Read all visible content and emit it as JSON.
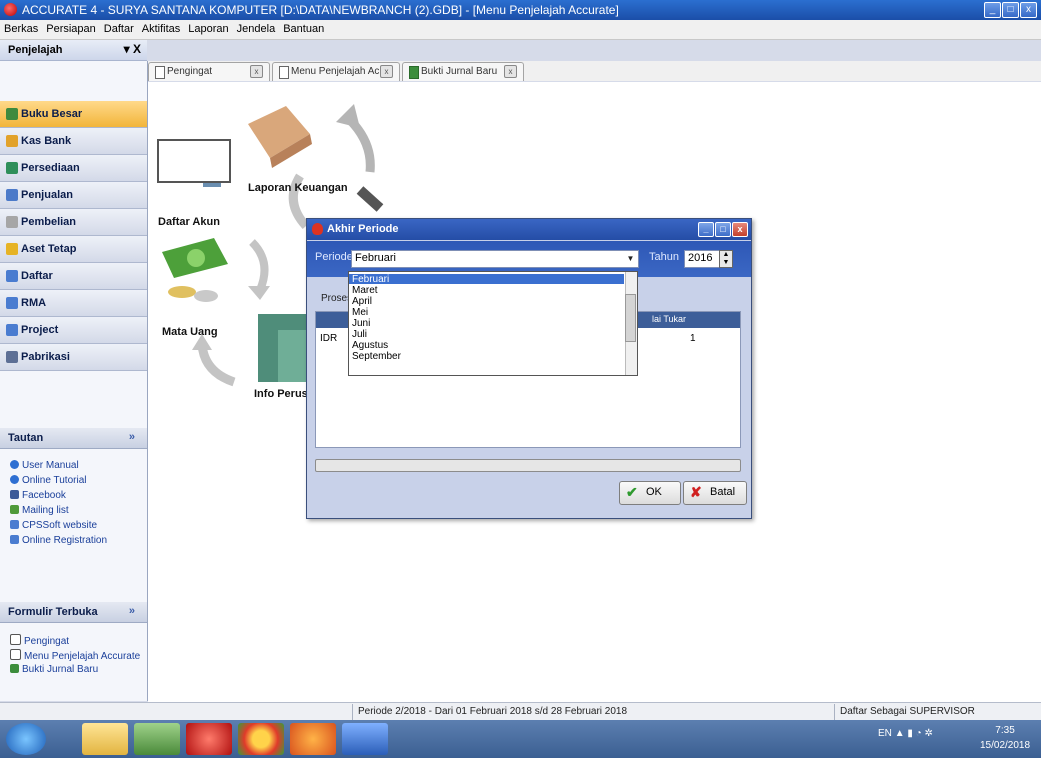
{
  "window": {
    "title": "ACCURATE 4 - SURYA SANTANA KOMPUTER  [D:\\DATA\\NEWBRANCH (2).GDB] - [Menu Penjelajah Accurate]",
    "controls": [
      "_",
      "□",
      "x"
    ]
  },
  "menu": [
    "Berkas",
    "Persiapan",
    "Daftar",
    "Aktifitas",
    "Laporan",
    "Jendela",
    "Bantuan"
  ],
  "explorer": {
    "title": "Penjelajah",
    "controls": "▾ X",
    "items": [
      {
        "label": "Buku Besar",
        "color": "#3e8a3e"
      },
      {
        "label": "Kas Bank",
        "color": "#e2a22a"
      },
      {
        "label": "Persediaan",
        "color": "#2f8f5a"
      },
      {
        "label": "Penjualan",
        "color": "#4c7ac9"
      },
      {
        "label": "Pembelian",
        "color": "#a6a6a6"
      },
      {
        "label": "Aset Tetap",
        "color": "#e6b325"
      },
      {
        "label": "Daftar",
        "color": "#4a7cd0"
      },
      {
        "label": "RMA",
        "color": "#4a7cd0"
      },
      {
        "label": "Project",
        "color": "#4a7cd0"
      },
      {
        "label": "Pabrikasi",
        "color": "#5d6f95"
      }
    ]
  },
  "tautan": {
    "title": "Tautan",
    "collapse": "»",
    "links": [
      "User Manual",
      "Online Tutorial",
      "Facebook",
      "Mailing list",
      "CPSSoft website",
      "Online Registration"
    ]
  },
  "formulir": {
    "title": "Formulir Terbuka",
    "collapse": "»",
    "links": [
      "Pengingat",
      "Menu Penjelajah Accurate",
      "Bukti Jurnal Baru"
    ]
  },
  "tabs": [
    {
      "label": "Pengingat",
      "close": "x"
    },
    {
      "label": "Menu Penjelajah Ac...",
      "close": "x"
    },
    {
      "label": "Bukti Jurnal Baru",
      "close": "x"
    }
  ],
  "main": {
    "labels": {
      "laporan": "Laporan Keuangan",
      "daftar_akun": "Daftar Akun",
      "mata_uang": "Mata Uang",
      "info": "Info Perusah"
    }
  },
  "dialog": {
    "title": "Akhir Periode",
    "periode_label": "Periode",
    "periode_value": "Februari",
    "tahun_label": "Tahun",
    "tahun_value": "2016",
    "proses_label": "Proses T",
    "grid_header": "lai Tukar",
    "grid_cell_currency": "IDR",
    "grid_cell_rate": "1",
    "ok_label": "OK",
    "batal_label": "Batal",
    "ok_glyph": "✔",
    "batal_glyph": "✘"
  },
  "dropdown": {
    "options": [
      "Februari",
      "Maret",
      "April",
      "Mei",
      "Juni",
      "Juli",
      "Agustus",
      "September"
    ],
    "selected": "Februari"
  },
  "statusbar": {
    "periode_text": "Periode 2/2018 - Dari 01 Februari 2018 s/d 28 Februari 2018",
    "user_text": "Daftar Sebagai SUPERVISOR"
  },
  "tray": {
    "lang": "EN",
    "time": "7:35",
    "date": "15/02/2018"
  }
}
